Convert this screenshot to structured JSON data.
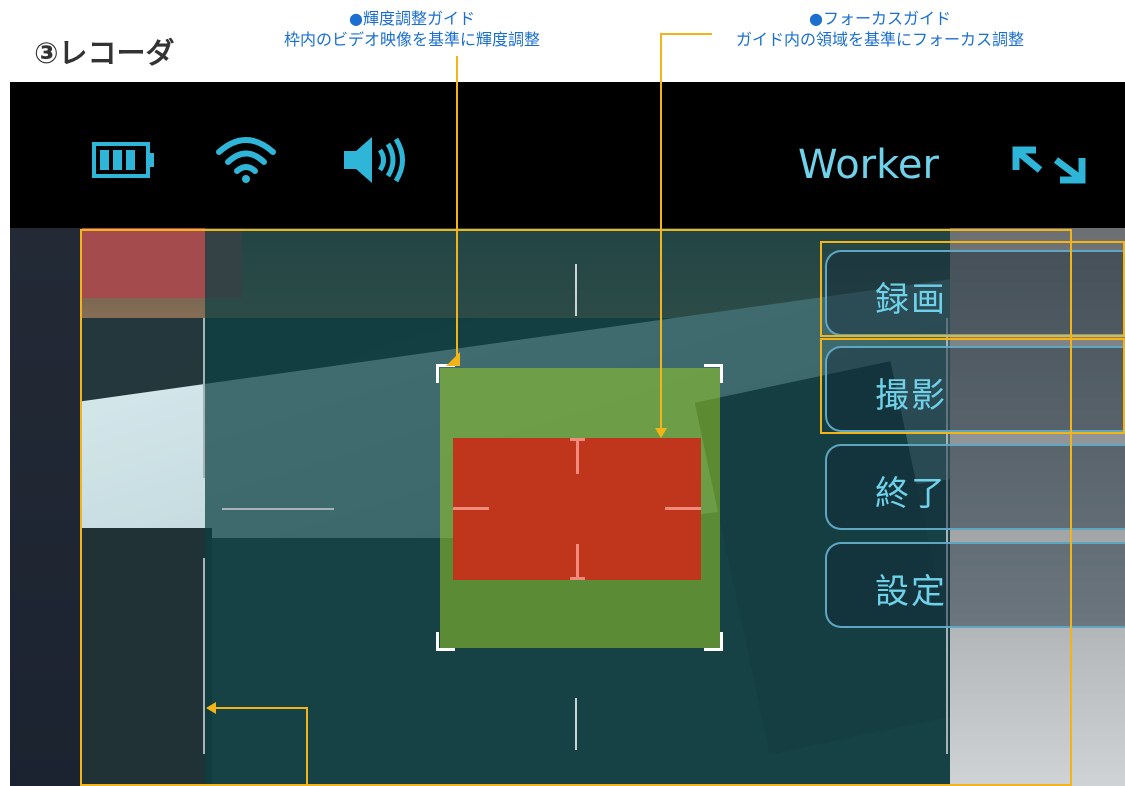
{
  "section_title": "③レコーダ",
  "annotations": {
    "brightness_guide": {
      "title": "●輝度調整ガイド",
      "desc": "枠内のビデオ映像を基準に輝度調整"
    },
    "focus_guide": {
      "title": "●フォーカスガイド",
      "desc": "ガイド内の領域を基準にフォーカス調整"
    }
  },
  "status_bar": {
    "icons": [
      "battery-icon",
      "wifi-icon",
      "speaker-icon"
    ],
    "user_label": "Worker",
    "expand_icon": "expand-arrows-icon"
  },
  "menu": {
    "items": [
      {
        "label": "録画"
      },
      {
        "label": "撮影"
      },
      {
        "label": "終了"
      },
      {
        "label": "設定"
      }
    ]
  },
  "colors": {
    "accent": "#2fb5d8",
    "annotation_line": "#f2b418",
    "annotation_text": "#1a6fd0",
    "brightness_box": "#96c828",
    "focus_box": "#c0361d"
  }
}
